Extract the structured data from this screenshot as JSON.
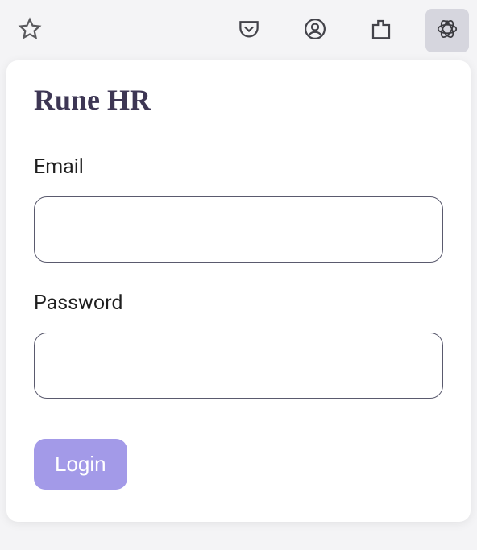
{
  "toolbar": {
    "icons": {
      "star": "star-icon",
      "pocket": "pocket-icon",
      "account": "account-icon",
      "extensions": "extensions-icon",
      "redux": "redux-devtools-icon"
    }
  },
  "card": {
    "title": "Rune HR",
    "email": {
      "label": "Email",
      "value": ""
    },
    "password": {
      "label": "Password",
      "value": ""
    },
    "login_button_label": "Login"
  }
}
